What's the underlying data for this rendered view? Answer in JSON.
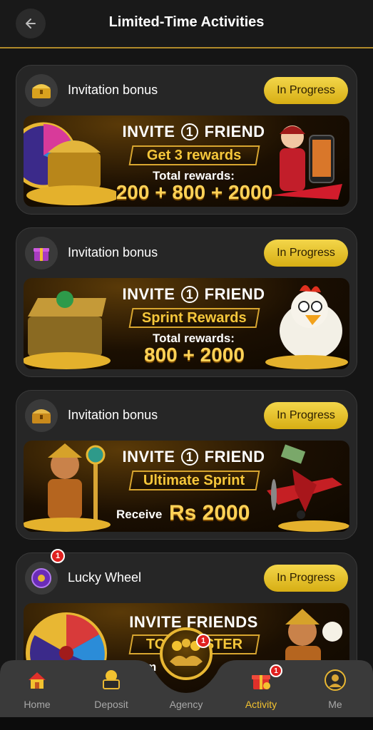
{
  "header": {
    "title": "Limited-Time Activities"
  },
  "cards": [
    {
      "title": "Invitation bonus",
      "status": "In Progress",
      "icon": "treasure-chest-icon",
      "banner": {
        "line1a": "INVITE",
        "line1_num": "1",
        "line1b": "FRIEND",
        "ribbon": "Get 3 rewards",
        "line3": "Total rewards:",
        "line4": "200 + 800 + 2000"
      }
    },
    {
      "title": "Invitation bonus",
      "status": "In Progress",
      "icon": "gift-box-icon",
      "banner": {
        "line1a": "INVITE",
        "line1_num": "1",
        "line1b": "FRIEND",
        "ribbon": "Sprint Rewards",
        "line3": "Total rewards:",
        "line4": "800 + 2000"
      }
    },
    {
      "title": "Invitation bonus",
      "status": "In Progress",
      "icon": "treasure-chest-icon",
      "banner": {
        "line1a": "INVITE",
        "line1_num": "1",
        "line1b": "FRIEND",
        "ribbon": "Ultimate Sprint",
        "line3": "Receive",
        "line4": "Rs 2000"
      }
    },
    {
      "title": "Lucky Wheel",
      "status": "In Progress",
      "icon": "lucky-wheel-icon",
      "badge": "1",
      "banner": {
        "line1a": "INVITE FRIENDS",
        "ribbon": "TO REGISTER",
        "line3": "Claim"
      }
    }
  ],
  "nav": {
    "items": [
      {
        "label": "Home",
        "icon": "home-icon"
      },
      {
        "label": "Deposit",
        "icon": "deposit-icon"
      },
      {
        "label": "Agency",
        "icon": "agency-icon",
        "badge": "1"
      },
      {
        "label": "Activity",
        "icon": "gift-icon",
        "badge": "1",
        "active": true
      },
      {
        "label": "Me",
        "icon": "avatar-icon"
      }
    ]
  },
  "colors": {
    "accent": "#f2c230",
    "status_bg": "#e8c429",
    "background": "#151515",
    "card": "#262626"
  }
}
